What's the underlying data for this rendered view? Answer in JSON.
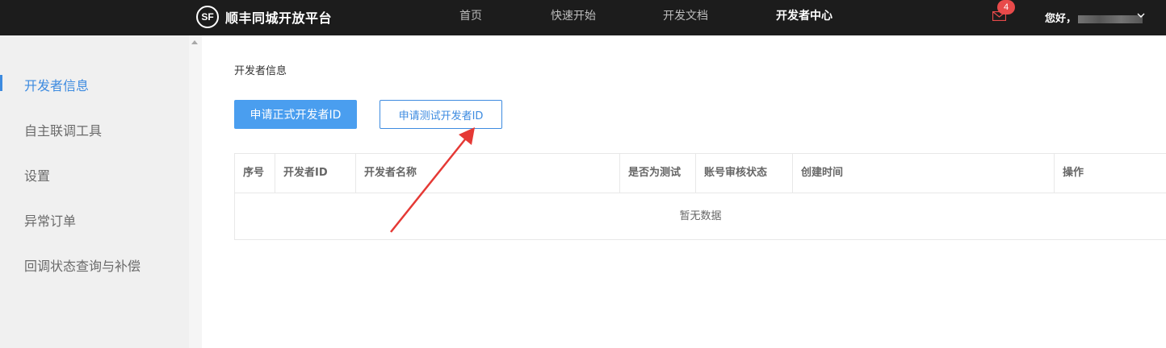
{
  "header": {
    "logo_mark": "SF",
    "brand": "顺丰同城开放平台",
    "nav": [
      {
        "label": "首页",
        "active": false
      },
      {
        "label": "快速开始",
        "active": false
      },
      {
        "label": "开发文档",
        "active": false
      },
      {
        "label": "开发者中心",
        "active": true
      }
    ],
    "message_count": "4",
    "greeting": "您好，"
  },
  "sidebar": {
    "items": [
      {
        "label": "开发者信息",
        "active": true
      },
      {
        "label": "自主联调工具",
        "active": false
      },
      {
        "label": "设置",
        "active": false
      },
      {
        "label": "异常订单",
        "active": false
      },
      {
        "label": "回调状态查询与补偿",
        "active": false
      }
    ]
  },
  "main": {
    "breadcrumb": "开发者信息",
    "primary_button": "申请正式开发者ID",
    "secondary_button": "申请测试开发者ID",
    "table": {
      "columns": [
        "序号",
        "开发者ID",
        "开发者名称",
        "是否为测试",
        "账号审核状态",
        "创建时间",
        "操作"
      ],
      "empty_text": "暂无数据"
    }
  },
  "colors": {
    "accent": "#3d8be0",
    "primary_button": "#4a9eef",
    "topbar": "#1c1c1c",
    "badge": "#e84a4a",
    "annotation_arrow": "#e53935"
  }
}
